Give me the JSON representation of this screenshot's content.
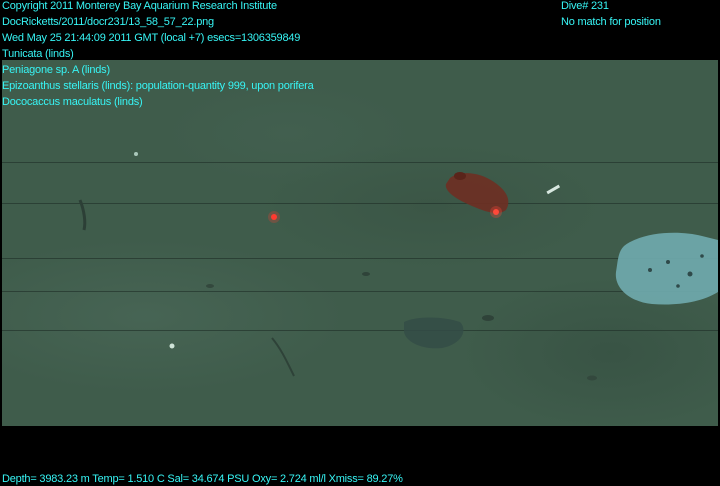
{
  "header": {
    "copyright": "Copyright 2011 Monterey Bay Aquarium Research Institute",
    "file_path": "DocRicketts/2011/docr231/13_58_57_22.png",
    "timestamp": "Wed May 25 21:44:09 2011 GMT (local +7)  esecs=1306359849",
    "dive": "Dive# 231",
    "position_status": "No match for position"
  },
  "annotations": [
    "Tunicata (linds)",
    "Peniagone sp. A (linds)",
    "Epizoanthus stellaris (linds): population-quantity 999, upon porifera",
    "Dococaccus maculatus (linds)"
  ],
  "footer": {
    "telemetry": "Depth= 3983.23 m  Temp= 1.510 C  Sal= 34.674 PSU  Oxy= 2.724 ml/l  Xmiss= 89.27%"
  },
  "colors": {
    "overlay_text": "#37f5f5",
    "seafloor": "#3f5c4b",
    "letterbox": "#000000",
    "laser_dot": "#ff3b30",
    "sea_cucumber": "#6e2f22",
    "sponge_patch": "#6fa9ad"
  }
}
